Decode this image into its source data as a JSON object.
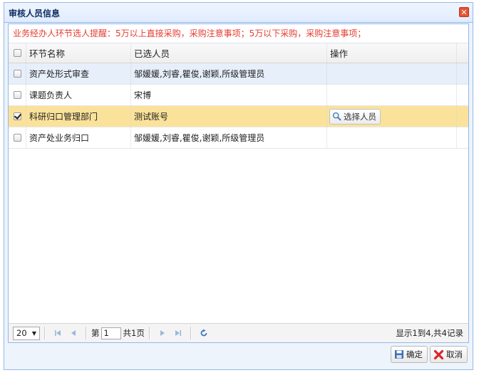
{
  "dialog": {
    "title": "审核人员信息",
    "close_icon": "close-icon"
  },
  "reminder": "业务经办人环节选人提醒：5万以上直接采购，采购注意事项；5万以下采购，采购注意事项；",
  "table": {
    "columns": [
      "环节名称",
      "已选人员",
      "操作"
    ],
    "rows": [
      {
        "name": "资产处形式审查",
        "people": "邹媛媛,刘睿,瞿俊,谢颖,所级管理员",
        "checked": false,
        "state": "hover",
        "action": ""
      },
      {
        "name": "课题负责人",
        "people": "宋博",
        "checked": false,
        "state": "",
        "action": ""
      },
      {
        "name": "科研归口管理部门",
        "people": "测试账号",
        "checked": true,
        "state": "selected",
        "action": "选择人员"
      },
      {
        "name": "资产处业务归口",
        "people": "邹媛媛,刘睿,瞿俊,谢颖,所级管理员",
        "checked": false,
        "state": "",
        "action": ""
      }
    ]
  },
  "pager": {
    "page_size": "20",
    "page_prefix": "第",
    "page_value": "1",
    "page_total": "共1页",
    "info": "显示1到4,共4记录"
  },
  "footer": {
    "ok_label": "确定",
    "cancel_label": "取消"
  },
  "colors": {
    "accent_red": "#e53b2f",
    "selected_row": "#fbe29b",
    "hover_row": "#e6effa",
    "border_blue": "#95b8e7"
  }
}
